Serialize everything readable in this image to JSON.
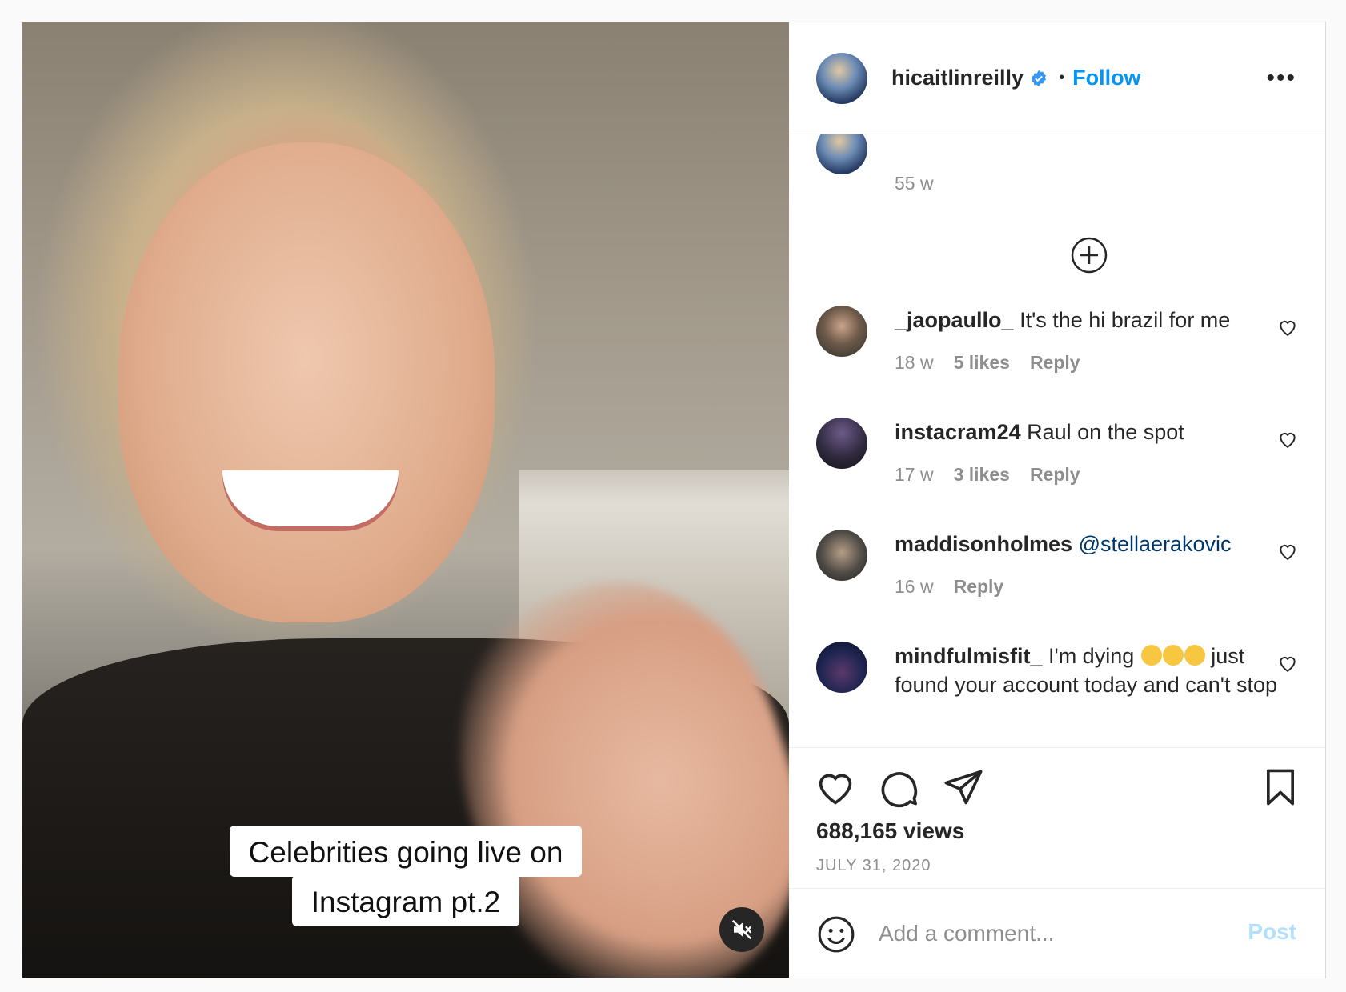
{
  "video": {
    "caption_line1": "Celebrities going live on",
    "caption_line2": "Instagram pt.2",
    "mute_icon": "muted-speaker-icon"
  },
  "header": {
    "username": "hicaitlinreilly",
    "verified_icon": "verified-badge-icon",
    "separator": "•",
    "follow_label": "Follow",
    "more_icon": "more-options-icon",
    "more_glyph": "•••"
  },
  "caption_comment": {
    "username": "hicaitlinreilly",
    "time": "55 w"
  },
  "load_more_icon": "plus-circle-icon",
  "comments": [
    {
      "username": "_jaopaullo_",
      "text": "It's the hi brazil for me",
      "time": "18 w",
      "likes": "5 likes",
      "reply": "Reply"
    },
    {
      "username": "instacram24",
      "text": "Raul on the spot",
      "time": "17 w",
      "likes": "3 likes",
      "reply": "Reply"
    },
    {
      "username": "maddisonholmes",
      "text": "@stellaerakovic",
      "time": "16 w",
      "reply": "Reply"
    },
    {
      "username": "mindfulmisfit_",
      "text": "I'm dying",
      "text2": "just found your account today and can't stop laughing THANK YOU!!"
    }
  ],
  "actions": {
    "like_icon": "heart-icon",
    "comment_icon": "comment-bubble-icon",
    "share_icon": "paper-plane-icon",
    "save_icon": "bookmark-icon",
    "views": "688,165 views",
    "date": "JULY 31, 2020"
  },
  "add_comment": {
    "emoji_icon": "smiley-icon",
    "placeholder": "Add a comment...",
    "post_label": "Post"
  },
  "colors": {
    "accent": "#0095f6",
    "mention": "#00376b",
    "secondary_text": "#8e8e8e",
    "post_disabled": "#b2dffc"
  }
}
